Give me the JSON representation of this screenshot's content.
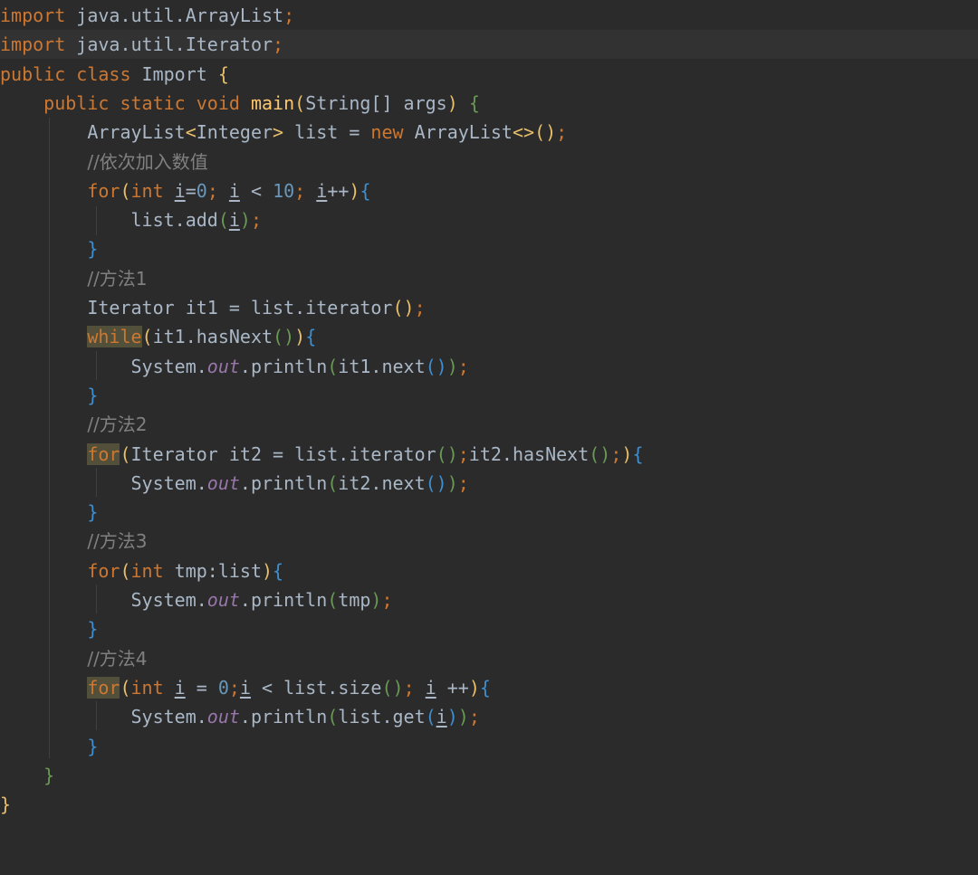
{
  "code": {
    "lines": [
      {
        "tokens": [
          {
            "t": "import",
            "c": "kw"
          },
          {
            "t": " java.util.ArrayList",
            "c": "pl"
          },
          {
            "t": ";",
            "c": "kw"
          }
        ]
      },
      {
        "tokens": [
          {
            "t": "import",
            "c": "kw"
          },
          {
            "t": " java.util.Iterator",
            "c": "pl"
          },
          {
            "t": ";",
            "c": "kw"
          }
        ],
        "current": true
      },
      {
        "tokens": [
          {
            "t": "public class",
            "c": "kw"
          },
          {
            "t": " Import ",
            "c": "pl"
          },
          {
            "t": "{",
            "c": "b1"
          }
        ]
      },
      {
        "tokens": [
          {
            "t": "    "
          },
          {
            "t": "public static void",
            "c": "kw"
          },
          {
            "t": " "
          },
          {
            "t": "main",
            "c": "fn"
          },
          {
            "t": "(",
            "c": "b1"
          },
          {
            "t": "String[] args",
            "c": "pl"
          },
          {
            "t": ")",
            "c": "b1"
          },
          {
            "t": " "
          },
          {
            "t": "{",
            "c": "b2"
          }
        ]
      },
      {
        "tokens": [
          {
            "t": "        "
          },
          {
            "t": "ArrayList",
            "c": "pl"
          },
          {
            "t": "<",
            "c": "b1"
          },
          {
            "t": "Integer",
            "c": "pl"
          },
          {
            "t": ">",
            "c": "b1"
          },
          {
            "t": " list = ",
            "c": "pl"
          },
          {
            "t": "new",
            "c": "kw"
          },
          {
            "t": " ArrayList",
            "c": "pl"
          },
          {
            "t": "<>",
            "c": "b1"
          },
          {
            "t": "()",
            "c": "b1"
          },
          {
            "t": ";",
            "c": "kw"
          }
        ]
      },
      {
        "tokens": [
          {
            "t": "        "
          },
          {
            "t": "//依次加入数值",
            "c": "cm cjk"
          }
        ]
      },
      {
        "tokens": [
          {
            "t": "        "
          },
          {
            "t": "for",
            "c": "kw"
          },
          {
            "t": "(",
            "c": "b1"
          },
          {
            "t": "int",
            "c": "kw"
          },
          {
            "t": " "
          },
          {
            "t": "i",
            "c": "pl u"
          },
          {
            "t": "=",
            "c": "pl"
          },
          {
            "t": "0",
            "c": "num"
          },
          {
            "t": "; ",
            "c": "kw"
          },
          {
            "t": "i",
            "c": "pl u"
          },
          {
            "t": " < ",
            "c": "pl"
          },
          {
            "t": "10",
            "c": "num"
          },
          {
            "t": "; ",
            "c": "kw"
          },
          {
            "t": "i",
            "c": "pl u"
          },
          {
            "t": "++",
            "c": "pl"
          },
          {
            "t": ")",
            "c": "b1"
          },
          {
            "t": "{",
            "c": "b3"
          }
        ]
      },
      {
        "tokens": [
          {
            "t": "            "
          },
          {
            "t": "list.add",
            "c": "pl"
          },
          {
            "t": "(",
            "c": "b2"
          },
          {
            "t": "i",
            "c": "pl u"
          },
          {
            "t": ")",
            "c": "b2"
          },
          {
            "t": ";",
            "c": "kw"
          }
        ]
      },
      {
        "tokens": [
          {
            "t": "        "
          },
          {
            "t": "}",
            "c": "b3"
          }
        ]
      },
      {
        "tokens": [
          {
            "t": "        "
          },
          {
            "t": "//方法1",
            "c": "cm cjk"
          }
        ]
      },
      {
        "tokens": [
          {
            "t": "        "
          },
          {
            "t": "Iterator it1 = list.iterator",
            "c": "pl"
          },
          {
            "t": "()",
            "c": "b1"
          },
          {
            "t": ";",
            "c": "kw"
          }
        ]
      },
      {
        "tokens": [
          {
            "t": "        "
          },
          {
            "t": "while",
            "c": "kw hl"
          },
          {
            "t": "(",
            "c": "b1"
          },
          {
            "t": "it1.hasNext",
            "c": "pl"
          },
          {
            "t": "()",
            "c": "b2"
          },
          {
            "t": ")",
            "c": "b1"
          },
          {
            "t": "{",
            "c": "b3"
          }
        ]
      },
      {
        "tokens": [
          {
            "t": "            "
          },
          {
            "t": "System.",
            "c": "pl"
          },
          {
            "t": "out",
            "c": "fld"
          },
          {
            "t": ".println",
            "c": "pl"
          },
          {
            "t": "(",
            "c": "b2"
          },
          {
            "t": "it1.next",
            "c": "pl"
          },
          {
            "t": "()",
            "c": "b3"
          },
          {
            "t": ")",
            "c": "b2"
          },
          {
            "t": ";",
            "c": "kw"
          }
        ]
      },
      {
        "tokens": [
          {
            "t": "        "
          },
          {
            "t": "}",
            "c": "b3"
          }
        ]
      },
      {
        "tokens": [
          {
            "t": "        "
          },
          {
            "t": "//方法2",
            "c": "cm cjk"
          }
        ]
      },
      {
        "tokens": [
          {
            "t": "        "
          },
          {
            "t": "for",
            "c": "kw hl"
          },
          {
            "t": "(",
            "c": "b1"
          },
          {
            "t": "Iterator it2 = list.iterator",
            "c": "pl"
          },
          {
            "t": "()",
            "c": "b2"
          },
          {
            "t": ";",
            "c": "kw"
          },
          {
            "t": "it2.hasNext",
            "c": "pl"
          },
          {
            "t": "()",
            "c": "b2"
          },
          {
            "t": ";",
            "c": "kw"
          },
          {
            "t": ")",
            "c": "b1"
          },
          {
            "t": "{",
            "c": "b3"
          }
        ]
      },
      {
        "tokens": [
          {
            "t": "            "
          },
          {
            "t": "System.",
            "c": "pl"
          },
          {
            "t": "out",
            "c": "fld"
          },
          {
            "t": ".println",
            "c": "pl"
          },
          {
            "t": "(",
            "c": "b2"
          },
          {
            "t": "it2.next",
            "c": "pl"
          },
          {
            "t": "()",
            "c": "b3"
          },
          {
            "t": ")",
            "c": "b2"
          },
          {
            "t": ";",
            "c": "kw"
          }
        ]
      },
      {
        "tokens": [
          {
            "t": "        "
          },
          {
            "t": "}",
            "c": "b3"
          }
        ]
      },
      {
        "tokens": [
          {
            "t": "        "
          },
          {
            "t": "//方法3",
            "c": "cm cjk"
          }
        ]
      },
      {
        "tokens": [
          {
            "t": "        "
          },
          {
            "t": "for",
            "c": "kw"
          },
          {
            "t": "(",
            "c": "b1"
          },
          {
            "t": "int",
            "c": "kw"
          },
          {
            "t": " tmp:list",
            "c": "pl"
          },
          {
            "t": ")",
            "c": "b1"
          },
          {
            "t": "{",
            "c": "b3"
          }
        ]
      },
      {
        "tokens": [
          {
            "t": "            "
          },
          {
            "t": "System.",
            "c": "pl"
          },
          {
            "t": "out",
            "c": "fld"
          },
          {
            "t": ".println",
            "c": "pl"
          },
          {
            "t": "(",
            "c": "b2"
          },
          {
            "t": "tmp",
            "c": "pl"
          },
          {
            "t": ")",
            "c": "b2"
          },
          {
            "t": ";",
            "c": "kw"
          }
        ]
      },
      {
        "tokens": [
          {
            "t": "        "
          },
          {
            "t": "}",
            "c": "b3"
          }
        ]
      },
      {
        "tokens": [
          {
            "t": "        "
          },
          {
            "t": "//方法4",
            "c": "cm cjk"
          }
        ]
      },
      {
        "tokens": [
          {
            "t": "        "
          },
          {
            "t": "for",
            "c": "kw hl"
          },
          {
            "t": "(",
            "c": "b1"
          },
          {
            "t": "int",
            "c": "kw"
          },
          {
            "t": " "
          },
          {
            "t": "i",
            "c": "pl u"
          },
          {
            "t": " = ",
            "c": "pl"
          },
          {
            "t": "0",
            "c": "num"
          },
          {
            "t": ";",
            "c": "kw"
          },
          {
            "t": "i",
            "c": "pl u"
          },
          {
            "t": " < list.size",
            "c": "pl"
          },
          {
            "t": "()",
            "c": "b2"
          },
          {
            "t": "; ",
            "c": "kw"
          },
          {
            "t": "i",
            "c": "pl u"
          },
          {
            "t": " ++",
            "c": "pl"
          },
          {
            "t": ")",
            "c": "b1"
          },
          {
            "t": "{",
            "c": "b3"
          }
        ]
      },
      {
        "tokens": [
          {
            "t": "            "
          },
          {
            "t": "System.",
            "c": "pl"
          },
          {
            "t": "out",
            "c": "fld"
          },
          {
            "t": ".println",
            "c": "pl"
          },
          {
            "t": "(",
            "c": "b2"
          },
          {
            "t": "list.get",
            "c": "pl"
          },
          {
            "t": "(",
            "c": "b3"
          },
          {
            "t": "i",
            "c": "pl u"
          },
          {
            "t": ")",
            "c": "b3"
          },
          {
            "t": ")",
            "c": "b2"
          },
          {
            "t": ";",
            "c": "kw"
          }
        ]
      },
      {
        "tokens": [
          {
            "t": "        "
          },
          {
            "t": "}",
            "c": "b3"
          }
        ]
      },
      {
        "tokens": [
          {
            "t": "    "
          },
          {
            "t": "}",
            "c": "b2"
          }
        ]
      },
      {
        "tokens": [
          {
            "t": "}",
            "c": "b1"
          }
        ]
      }
    ]
  }
}
